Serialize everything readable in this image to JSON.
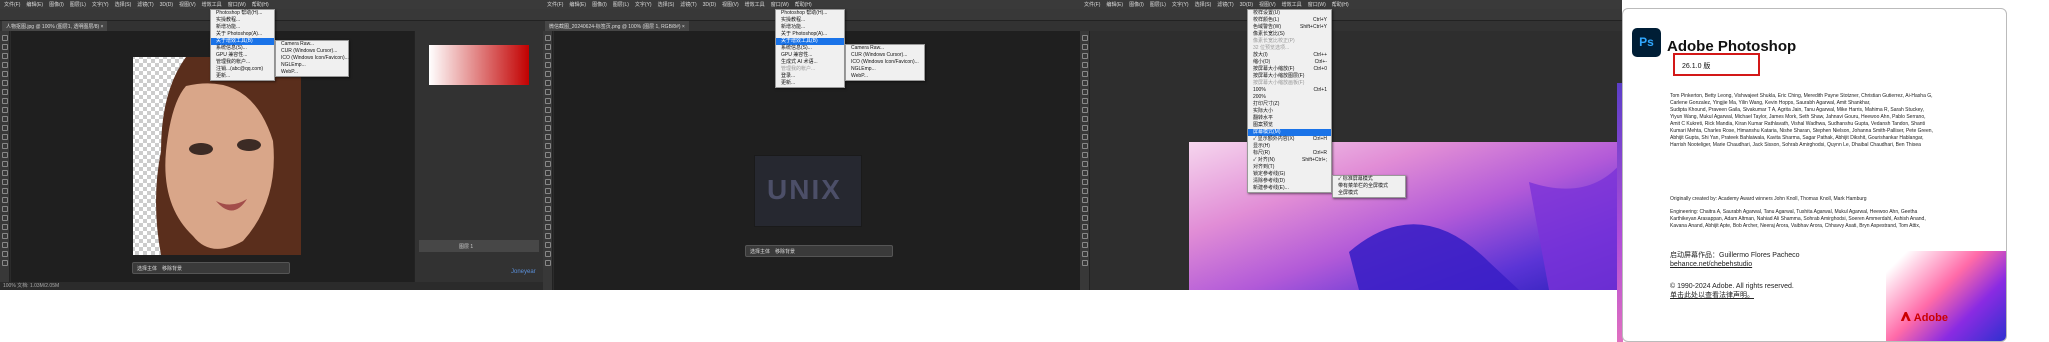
{
  "colors": {
    "ps_dark": "#2b2b2b",
    "menu_bg": "#f0f0f0",
    "menu_highlight": "#1a73e8",
    "about_red": "#d31818",
    "adobe_red": "#cc0000"
  },
  "win1": {
    "menubar": [
      "文件(F)",
      "编辑(E)",
      "图像(I)",
      "图层(L)",
      "文字(Y)",
      "选择(S)",
      "滤镜(T)",
      "3D(D)",
      "视图(V)",
      "增效工具",
      "窗口(W)",
      "帮助(H)"
    ],
    "tab_label": "人物抠图.jpg @ 100% (图层1, 透明图层/8) ×",
    "help_menu": [
      {
        "label": "Photoshop 帮助(H)...",
        "highlight": false,
        "disabled": false
      },
      {
        "label": "实操教程...",
        "highlight": false,
        "disabled": false
      },
      {
        "label": "新增功能...",
        "highlight": false,
        "disabled": false
      },
      {
        "label": "关于 Photoshop(A)...",
        "highlight": false,
        "disabled": false
      },
      {
        "label": "关于增效工具(B)",
        "highlight": true,
        "disabled": false
      },
      {
        "label": "系统信息(S)...",
        "highlight": false,
        "disabled": false
      },
      {
        "label": "GPU 兼容性...",
        "highlight": false,
        "disabled": false
      },
      {
        "label": "管理我的帐户...",
        "highlight": false,
        "disabled": false
      },
      {
        "label": "注销...(abc@qq.com)",
        "highlight": false,
        "disabled": false
      },
      {
        "label": "更新...",
        "highlight": false,
        "disabled": false
      }
    ],
    "plugins_submenu": [
      "Camera Raw...",
      "CUR (Windows Cursor)...",
      "ICO (Windows Icon/Favicon)...",
      "NGLEmp...",
      "WebP..."
    ],
    "contextual": [
      "选择主体",
      "移除背景"
    ],
    "status": "100%  文档: 1.03M/2.05M",
    "layer_name": "图层 1",
    "watermark": "Joneyear"
  },
  "win2": {
    "tab_label": "微信截图_20240624-标签页.png @ 100% (图层 1, RGB/8#) ×",
    "help_menu": [
      {
        "label": "Photoshop 帮助(H)...",
        "highlight": false,
        "disabled": false
      },
      {
        "label": "实操教程...",
        "highlight": false,
        "disabled": false
      },
      {
        "label": "新增功能...",
        "highlight": false,
        "disabled": false
      },
      {
        "label": "关于 Photoshop(A)...",
        "highlight": false,
        "disabled": false
      },
      {
        "label": "关于增效工具(B)",
        "highlight": true,
        "disabled": false
      },
      {
        "label": "系统信息(S)...",
        "highlight": false,
        "disabled": false
      },
      {
        "label": "GPU 兼容性...",
        "highlight": false,
        "disabled": false
      },
      {
        "label": "生成式 AI 术语...",
        "highlight": false,
        "disabled": false
      },
      {
        "label": "管理我的帐户...",
        "highlight": false,
        "disabled": true
      },
      {
        "label": "登录...",
        "highlight": false,
        "disabled": false
      },
      {
        "label": "更新...",
        "highlight": false,
        "disabled": false
      }
    ],
    "plugins_submenu": [
      "Camera Raw...",
      "CUR (Windows Cursor)...",
      "ICO (Windows Icon/Favicon)...",
      "NGLEmp...",
      "WebP..."
    ],
    "canvas_text": "UNIX",
    "contextual": [
      "选择主体",
      "移除背景"
    ]
  },
  "win3": {
    "view_menu": [
      {
        "label": "校样设置(U)",
        "shortcut": "",
        "highlight": false,
        "disabled": false
      },
      {
        "label": "校样颜色(L)",
        "shortcut": "Ctrl+Y",
        "highlight": false,
        "disabled": false
      },
      {
        "label": "色域警告(W)",
        "shortcut": "Shift+Ctrl+Y",
        "highlight": false,
        "disabled": false
      },
      {
        "label": "像素长宽比(S)",
        "shortcut": "",
        "highlight": false,
        "disabled": false
      },
      {
        "label": "像素长宽比校正(P)",
        "shortcut": "",
        "highlight": false,
        "disabled": true
      },
      {
        "label": "32 位预览选项...",
        "shortcut": "",
        "highlight": false,
        "disabled": true
      },
      {
        "label": "放大(I)",
        "shortcut": "Ctrl++",
        "highlight": false,
        "disabled": false
      },
      {
        "label": "缩小(O)",
        "shortcut": "Ctrl+-",
        "highlight": false,
        "disabled": false
      },
      {
        "label": "按屏幕大小缩放(F)",
        "shortcut": "Ctrl+0",
        "highlight": false,
        "disabled": false
      },
      {
        "label": "按屏幕大小缩放图层(F)",
        "shortcut": "",
        "highlight": false,
        "disabled": false
      },
      {
        "label": "按屏幕大小缩放画板(F)",
        "shortcut": "",
        "highlight": false,
        "disabled": true
      },
      {
        "label": "100%",
        "shortcut": "Ctrl+1",
        "highlight": false,
        "disabled": false
      },
      {
        "label": "200%",
        "shortcut": "",
        "highlight": false,
        "disabled": false
      },
      {
        "label": "打印尺寸(Z)",
        "shortcut": "",
        "highlight": false,
        "disabled": false
      },
      {
        "label": "实际大小",
        "shortcut": "",
        "highlight": false,
        "disabled": false
      },
      {
        "label": "翻转水平",
        "shortcut": "",
        "highlight": false,
        "disabled": false
      },
      {
        "label": "图案预览",
        "shortcut": "",
        "highlight": false,
        "disabled": false
      },
      {
        "label": "屏幕模式(M)",
        "shortcut": "",
        "highlight": true,
        "disabled": false
      },
      {
        "label": "✓ 显示额外内容(X)",
        "shortcut": "Ctrl+H",
        "highlight": false,
        "disabled": false
      },
      {
        "label": "显示(H)",
        "shortcut": "",
        "highlight": false,
        "disabled": false
      },
      {
        "label": "标尺(R)",
        "shortcut": "Ctrl+R",
        "highlight": false,
        "disabled": false
      },
      {
        "label": "✓ 对齐(N)",
        "shortcut": "Shift+Ctrl+;",
        "highlight": false,
        "disabled": false
      },
      {
        "label": "对齐到(T)",
        "shortcut": "",
        "highlight": false,
        "disabled": false
      },
      {
        "label": "锁定参考线(G)",
        "shortcut": "",
        "highlight": false,
        "disabled": false
      },
      {
        "label": "清除参考线(D)",
        "shortcut": "",
        "highlight": false,
        "disabled": false
      },
      {
        "label": "新建参考线(E)...",
        "shortcut": "",
        "highlight": false,
        "disabled": false
      }
    ],
    "screen_mode_submenu": [
      "✓ 标准屏幕模式",
      "带有菜单栏的全屏模式",
      "全屏模式"
    ]
  },
  "about": {
    "product": "Adobe Photoshop",
    "logo_text": "Ps",
    "version": "26.1.0 版",
    "credits": [
      "Tom Pinkerton, Betty Leong, Vishwajeet Shukla, Eric Ching, Meredith Payne Stotzner, Christian Gutierrez, Ai-Hasha G,",
      "Carlene Gonzalez, Yingjie Ma, Yilin Wang, Kevin Hopps, Saurabh Agarwal, Amit Shankhar,",
      "Sudipta Khound, Praveen Gaila, Sivakumar T A, Agrita Jain, Tanu Agarwal, Mike Harris, Mahima R, Sarah Stuckey,",
      "Yiyun Wang, Mukul Agarwal, Michael Taylor, James Mork, Seth Shaw, Jahnavi Gouru, Heewoo Ahn, Pablo Serrano,",
      "Amit C Kukreti, Rick Mandia, Kiran Kumar Rathlavath, Vishal Wadhwa, Sudhanshu Gupta, Vedansh Tandon, Shanti",
      "Kumari Mehta, Charles Rose, Himanshu Kataria, Nishe Sharan, Stephen Nielson, Johanna Smith-Palliser, Pete Green,",
      "Abhijit Gupta, Shi Yan, Prateek Bahlaiwala, Kavita Sharma, Sagar Pathak, Abhijit Dikshit, Gourishankar Hablangar,",
      "Harrish Nooteliger, Marie Chaudhari, Jack Sisson, Sohrab Amirghodsi, Quynn Le, Dhaibal Chaudhari, Ben Thisea"
    ],
    "initial": "Originally created by: Academy Award winners John Knoll, Thomas Knoll, Mark Hamburg",
    "engineering": [
      "Engineering: Chaitra A, Saurabh Agarwal, Tanu Agarwal, Tushita Agarwal, Mukul Agarwal, Heewoo Ahn, Geetha",
      "Karthikeyan Arasappan, Adam Altman, Nahiad Ali Shamma, Sohrab Amirghodsi, Soeren Ammerdahl, Ashish Anand,",
      "Kavana Anand, Abhijit Apte, Bob Archer, Neeraj Arora, Vaibhav Arora, Chhavvy Asati, Bryn Aspestrand, Tom Attix,"
    ],
    "splash": "启动屏幕作品：Guillermo Flores Pacheco",
    "splash_link": "behance.net/chebehstudio",
    "copyright": "© 1990-2024 Adobe. All rights reserved.",
    "legal_link": "单击此处以查看法律声明。",
    "adobe_word": "Adobe"
  }
}
